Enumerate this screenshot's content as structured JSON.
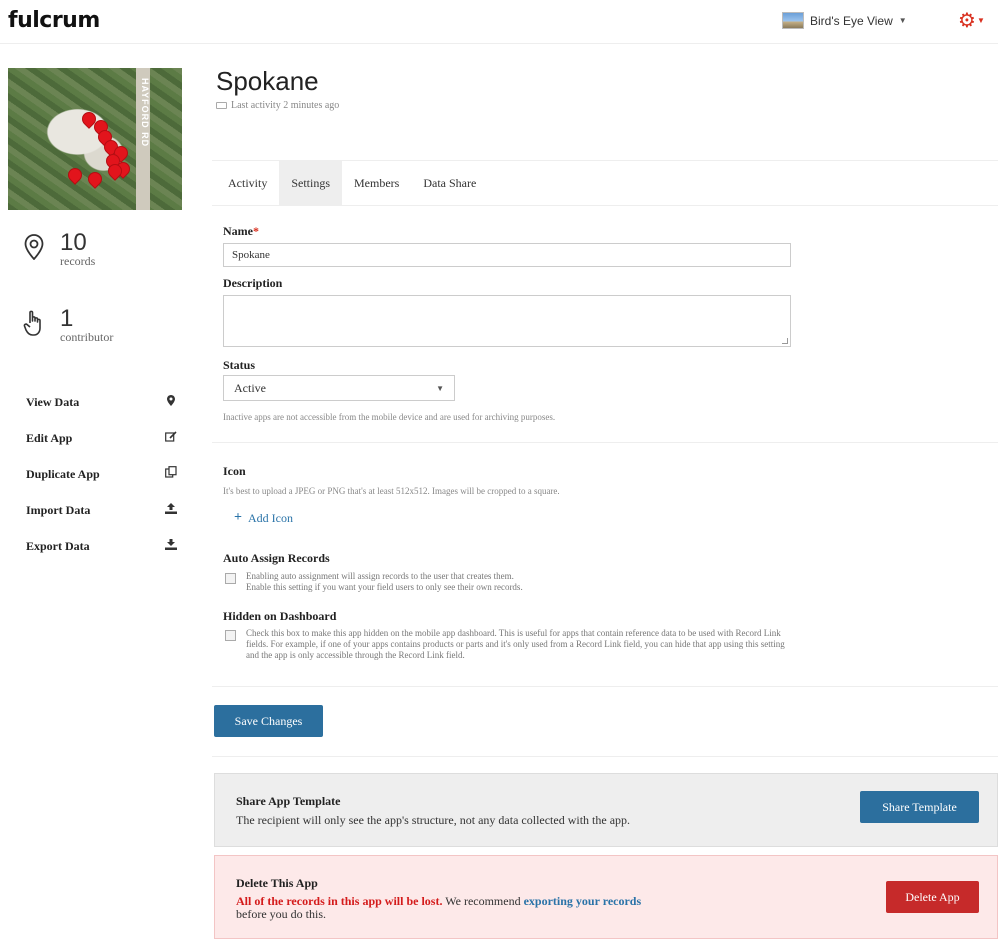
{
  "brand": {
    "logo": "fulcrum"
  },
  "header": {
    "org_name": "Bird's Eye View"
  },
  "sidebar": {
    "map_road_label": "HAYFORD RD",
    "stats": [
      {
        "count": "10",
        "label": "records",
        "icon": "map-pin-outline-icon"
      },
      {
        "count": "1",
        "label": "contributor",
        "icon": "hand-pointer-icon"
      }
    ],
    "nav": [
      {
        "label": "View Data",
        "icon": "map-marker-icon"
      },
      {
        "label": "Edit App",
        "icon": "edit-icon"
      },
      {
        "label": "Duplicate App",
        "icon": "duplicate-icon"
      },
      {
        "label": "Import Data",
        "icon": "upload-icon"
      },
      {
        "label": "Export Data",
        "icon": "download-icon"
      }
    ]
  },
  "app": {
    "title": "Spokane",
    "last_activity": "Last activity 2 minutes ago"
  },
  "tabs": [
    {
      "label": "Activity",
      "active": false
    },
    {
      "label": "Settings",
      "active": true
    },
    {
      "label": "Members",
      "active": false
    },
    {
      "label": "Data Share",
      "active": false
    }
  ],
  "form": {
    "name_label": "Name",
    "name_required": "*",
    "name_value": "Spokane",
    "description_label": "Description",
    "description_value": "",
    "status_label": "Status",
    "status_value": "Active",
    "status_help": "Inactive apps are not accessible from the mobile device and are used for archiving purposes.",
    "icon_label": "Icon",
    "icon_help": "It's best to upload a JPEG or PNG that's at least 512x512. Images will be cropped to a square.",
    "add_icon_label": "Add Icon",
    "auto_assign_label": "Auto Assign Records",
    "auto_assign_text_1": "Enabling auto assignment will assign records to the user that creates them.",
    "auto_assign_text_2": "Enable this setting if you want your field users to only see their own records.",
    "auto_assign_checked": false,
    "hidden_label": "Hidden on Dashboard",
    "hidden_text_1": "Check this box to make this app hidden on the mobile app dashboard. This is useful for apps that contain reference data to be used with Record Link",
    "hidden_text_2": "fields. For example, if one of your apps contains products or parts and it's only used from a Record Link field, you can hide that app using this setting",
    "hidden_text_3": "and the app is only accessible through the Record Link field.",
    "hidden_checked": false,
    "save_label": "Save Changes"
  },
  "share_panel": {
    "title": "Share App Template",
    "text": "The recipient will only see the app's structure, not any data collected with the app.",
    "button_label": "Share Template"
  },
  "delete_panel": {
    "title": "Delete This App",
    "warning": "All of the records in this app will be lost.",
    "text_before_link": " We recommend ",
    "link_text": "exporting your records",
    "text_after": "before you do this.",
    "button_label": "Delete App"
  },
  "colors": {
    "accent": "#2c6f9e",
    "danger": "#c62a2a",
    "required": "#d9301f",
    "link": "#2a73a8",
    "map_pin": "#e2141c"
  }
}
